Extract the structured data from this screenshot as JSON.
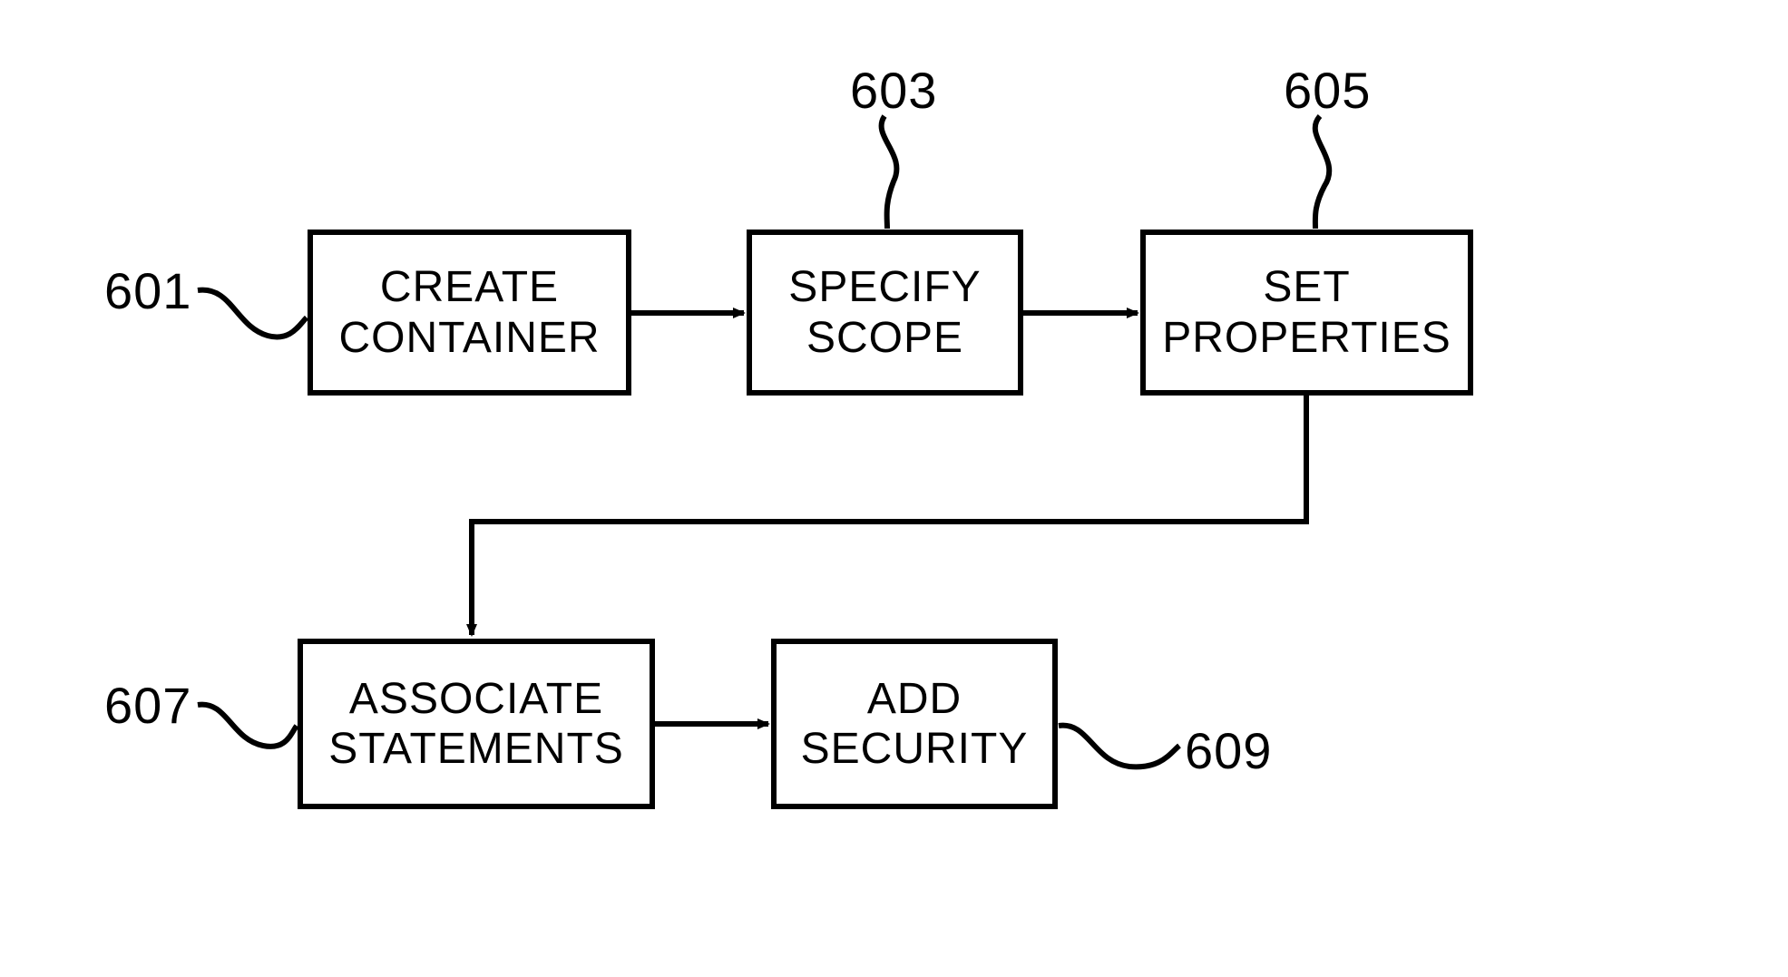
{
  "diagram": {
    "boxes": {
      "b601": {
        "text": "CREATE\nCONTAINER"
      },
      "b603": {
        "text": "SPECIFY\nSCOPE"
      },
      "b605": {
        "text": "SET\nPROPERTIES"
      },
      "b607": {
        "text": "ASSOCIATE\nSTATEMENTS"
      },
      "b609": {
        "text": "ADD\nSECURITY"
      }
    },
    "labels": {
      "l601": "601",
      "l603": "603",
      "l605": "605",
      "l607": "607",
      "l609": "609"
    }
  }
}
